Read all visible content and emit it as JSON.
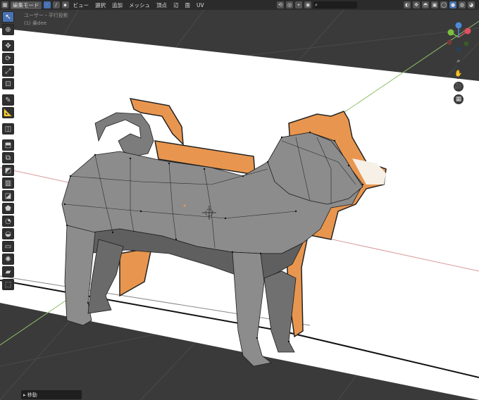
{
  "header": {
    "mode": "編集モード",
    "menus": [
      "ビュー",
      "選択",
      "追加",
      "メッシュ",
      "頂点",
      "辺",
      "面",
      "UV"
    ]
  },
  "viewport": {
    "view_name": "ユーザー・平行投影",
    "object_name": "(1) 柴dee"
  },
  "toolbar": {
    "tools": [
      "select-box",
      "cursor",
      "move",
      "rotate",
      "scale",
      "transform",
      "annotate",
      "measure",
      "add-cube",
      "extrude",
      "inset",
      "bevel",
      "loop-cut",
      "knife",
      "poly-build",
      "spin",
      "smooth",
      "edge-slide",
      "shrink-fatten",
      "shear",
      "rip"
    ]
  },
  "nav": {
    "gizmo_axes": [
      "X",
      "Y",
      "Z"
    ]
  },
  "status": {
    "last_op": "移動"
  },
  "colors": {
    "background": "#3b3b3b",
    "floor": "#ffffff",
    "mesh_gray": "#8c8c8c",
    "mesh_orange": "#e8964f",
    "accent": "#4772b3"
  }
}
